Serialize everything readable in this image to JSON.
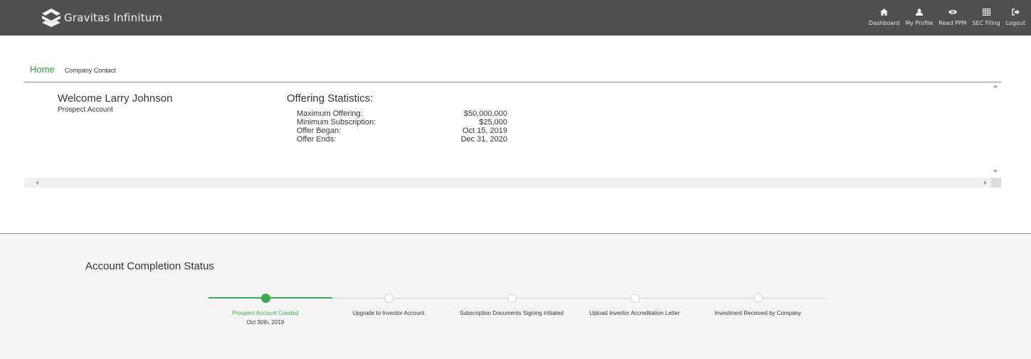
{
  "brand": {
    "name": "Gravitas Infinitum"
  },
  "topnav": [
    {
      "label": "Dashboard",
      "icon": "home-icon"
    },
    {
      "label": "My Profile",
      "icon": "user-icon"
    },
    {
      "label": "Read PPM",
      "icon": "eye-icon"
    },
    {
      "label": "SEC Filing",
      "icon": "table-icon"
    },
    {
      "label": "Logout",
      "icon": "logout-icon"
    }
  ],
  "subnav": {
    "home": "Home",
    "contact": "Company Contact"
  },
  "welcome": {
    "greeting": "Welcome Larry Johnson",
    "account_type": "Prospect Account"
  },
  "stats": {
    "title": "Offering Statistics:",
    "rows": [
      {
        "label": "Maximum Offering:",
        "value": "$50,000,000"
      },
      {
        "label": "Minimum Subscription:",
        "value": "$25,000"
      },
      {
        "label": "Offer Began:",
        "value": "Oct 15, 2019"
      },
      {
        "label": "Offer Ends:",
        "value": "Dec 31, 2020"
      }
    ]
  },
  "completion": {
    "title": "Account Completion Status",
    "steps": [
      {
        "label": "Prospect Account Created",
        "date": "Oct 30th, 2019",
        "done": true
      },
      {
        "label": "Upgrade to Investor Account",
        "date": "",
        "done": false
      },
      {
        "label": "Subscription Documents Signing Initiated",
        "date": "",
        "done": false
      },
      {
        "label": "Upload Investor Accreditation Letter",
        "date": "",
        "done": false
      },
      {
        "label": "Investment Received by Company",
        "date": "",
        "done": false
      }
    ]
  },
  "colors": {
    "accent": "#3aaa4a",
    "topbar": "#505050",
    "status_bg": "#f5f5f5"
  }
}
